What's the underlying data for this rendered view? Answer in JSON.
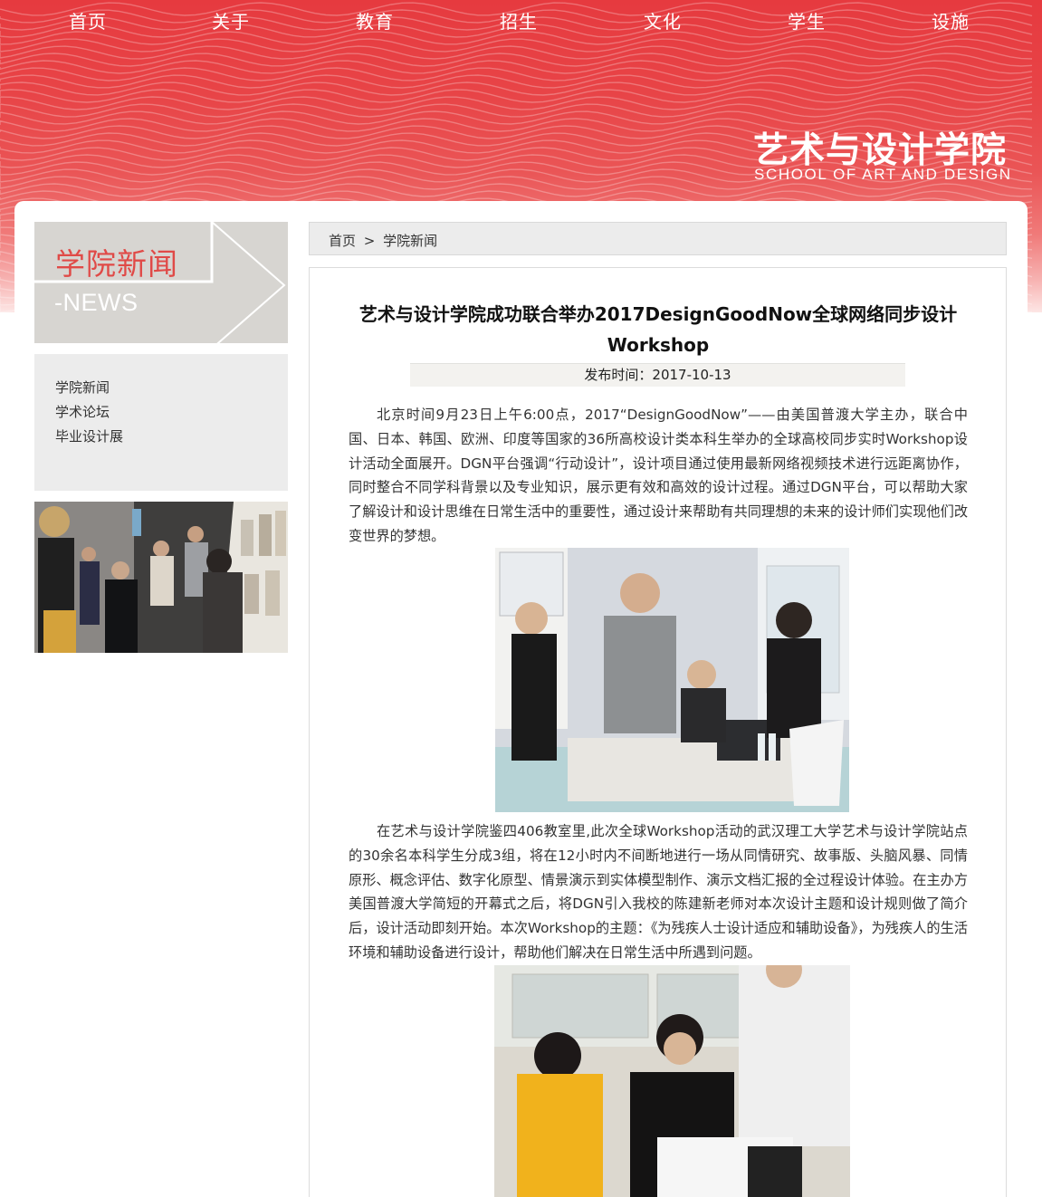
{
  "nav": {
    "items": [
      "首页",
      "关于",
      "教育",
      "招生",
      "文化",
      "学生",
      "设施"
    ]
  },
  "logo": {
    "cn": "艺术与设计学院",
    "en": "SCHOOL OF ART AND DESIGN"
  },
  "sidebar": {
    "section_title": "学院新闻",
    "section_sub": "-NEWS",
    "menu": [
      "学院新闻",
      "学术论坛",
      "毕业设计展"
    ]
  },
  "breadcrumb": {
    "home": "首页",
    "separator": ">",
    "current": "学院新闻"
  },
  "article": {
    "title": "艺术与设计学院成功联合举办2017DesignGoodNow全球网络同步设计Workshop",
    "publish_label": "发布时间：",
    "publish_date": "2017-10-13",
    "para1": "北京时间9月23日上午6:00点，2017“DesignGoodNow”——由美国普渡大学主办，联合中国、日本、韩国、欧洲、印度等国家的36所高校设计类本科生举办的全球高校同步实时Workshop设计活动全面展开。DGN平台强调“行动设计”，设计项目通过使用最新网络视频技术进行远距离协作，同时整合不同学科背景以及专业知识，展示更有效和高效的设计过程。通过DGN平台，可以帮助大家了解设计和设计思维在日常生活中的重要性，通过设计来帮助有共同理想的未来的设计师们实现他们改变世界的梦想。",
    "para2": "在艺术与设计学院鉴四406教室里,此次全球Workshop活动的武汉理工大学艺术与设计学院站点的30余名本科学生分成3组，将在12小时内不间断地进行一场从同情研究、故事版、头脑风暴、同情原形、概念评估、数字化原型、情景演示到实体模型制作、演示文档汇报的全过程设计体验。在主办方美国普渡大学简短的开幕式之后，将DGN引入我校的陈建新老师对本次设计主题和设计规则做了简介后，设计活动即刻开始。本次Workshop的主题：《为残疾人士设计适应和辅助设备》，为残疾人的生活环境和辅助设备进行设计，帮助他们解决在日常生活中所遇到问题。"
  },
  "colors": {
    "banner_red": "#e63a3f",
    "accent_red": "#e04a47",
    "sidebar_gray": "#d7d5d1"
  }
}
